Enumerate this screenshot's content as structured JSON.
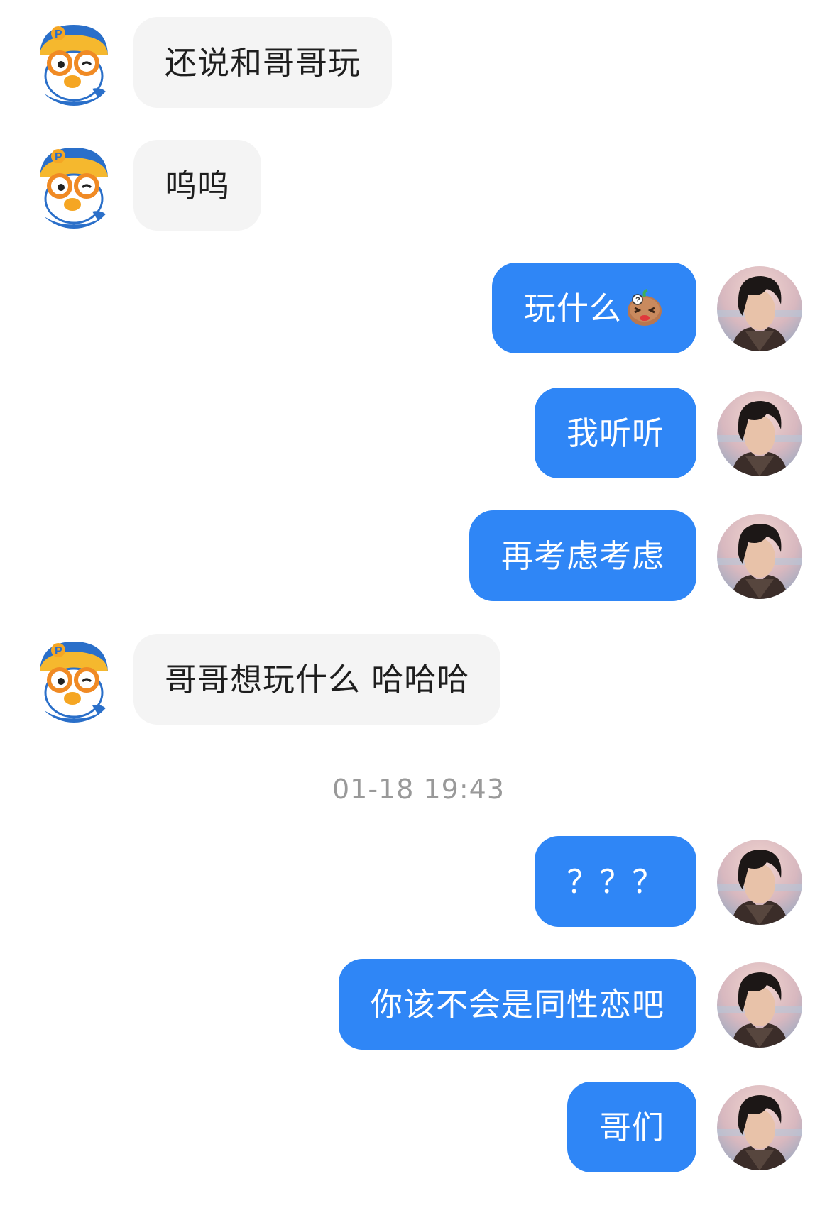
{
  "messages": [
    {
      "side": "in",
      "text": "还说和哥哥玩"
    },
    {
      "side": "in",
      "text": "呜呜"
    },
    {
      "side": "out",
      "text": "玩什么",
      "emoji": "surprised-potato-emoji"
    },
    {
      "side": "out",
      "text": "我听听"
    },
    {
      "side": "out",
      "text": "再考虑考虑"
    },
    {
      "side": "in",
      "text": "哥哥想玩什么 哈哈哈"
    },
    {
      "side": "out",
      "text": "？？？"
    },
    {
      "side": "out",
      "text": "你该不会是同性恋吧"
    },
    {
      "side": "out",
      "text": "哥们"
    }
  ],
  "timestamp": "01-18 19:43",
  "avatars": {
    "contact": "pororo-penguin-avatar",
    "self": "young-man-photo-avatar"
  },
  "colors": {
    "outgoing_bubble": "#2f86f6",
    "incoming_bubble": "#f4f4f4",
    "timestamp": "#999999",
    "background": "#ffffff"
  }
}
